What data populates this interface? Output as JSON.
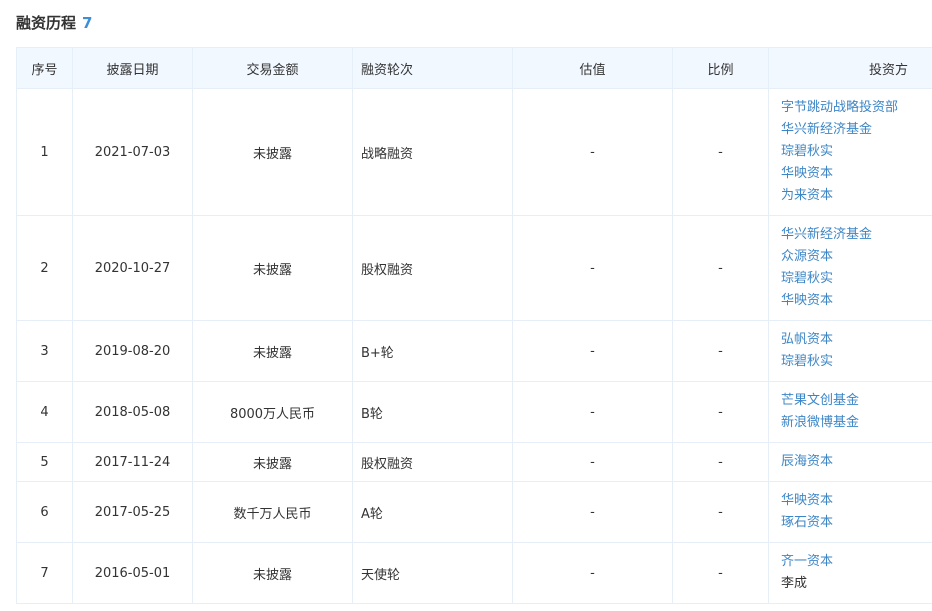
{
  "header": {
    "title": "融资历程",
    "count": "7"
  },
  "table": {
    "columns": [
      "序号",
      "披露日期",
      "交易金额",
      "融资轮次",
      "估值",
      "比例",
      "投资方"
    ],
    "rows": [
      {
        "index": "1",
        "date": "2021-07-03",
        "amount": "未披露",
        "round": "战略融资",
        "valuation": "-",
        "ratio": "-",
        "investors": [
          {
            "name": "字节跳动战略投资部",
            "linked": true
          },
          {
            "name": "华兴新经济基金",
            "linked": true
          },
          {
            "name": "琮碧秋实",
            "linked": true
          },
          {
            "name": "华映资本",
            "linked": true
          },
          {
            "name": "为来资本",
            "linked": true
          }
        ]
      },
      {
        "index": "2",
        "date": "2020-10-27",
        "amount": "未披露",
        "round": "股权融资",
        "valuation": "-",
        "ratio": "-",
        "investors": [
          {
            "name": "华兴新经济基金",
            "linked": true
          },
          {
            "name": "众源资本",
            "linked": true
          },
          {
            "name": "琮碧秋实",
            "linked": true
          },
          {
            "name": "华映资本",
            "linked": true
          }
        ]
      },
      {
        "index": "3",
        "date": "2019-08-20",
        "amount": "未披露",
        "round": "B+轮",
        "valuation": "-",
        "ratio": "-",
        "investors": [
          {
            "name": "弘帆资本",
            "linked": true
          },
          {
            "name": "琮碧秋实",
            "linked": true
          }
        ]
      },
      {
        "index": "4",
        "date": "2018-05-08",
        "amount": "8000万人民币",
        "round": "B轮",
        "valuation": "-",
        "ratio": "-",
        "investors": [
          {
            "name": "芒果文创基金",
            "linked": true
          },
          {
            "name": "新浪微博基金",
            "linked": true
          }
        ]
      },
      {
        "index": "5",
        "date": "2017-11-24",
        "amount": "未披露",
        "round": "股权融资",
        "valuation": "-",
        "ratio": "-",
        "investors": [
          {
            "name": "辰海资本",
            "linked": true
          }
        ]
      },
      {
        "index": "6",
        "date": "2017-05-25",
        "amount": "数千万人民币",
        "round": "A轮",
        "valuation": "-",
        "ratio": "-",
        "investors": [
          {
            "name": "华映资本",
            "linked": true
          },
          {
            "name": "琢石资本",
            "linked": true
          }
        ]
      },
      {
        "index": "7",
        "date": "2016-05-01",
        "amount": "未披露",
        "round": "天使轮",
        "valuation": "-",
        "ratio": "-",
        "investors": [
          {
            "name": "齐一资本",
            "linked": true
          },
          {
            "name": "李成",
            "linked": false
          }
        ]
      }
    ]
  }
}
